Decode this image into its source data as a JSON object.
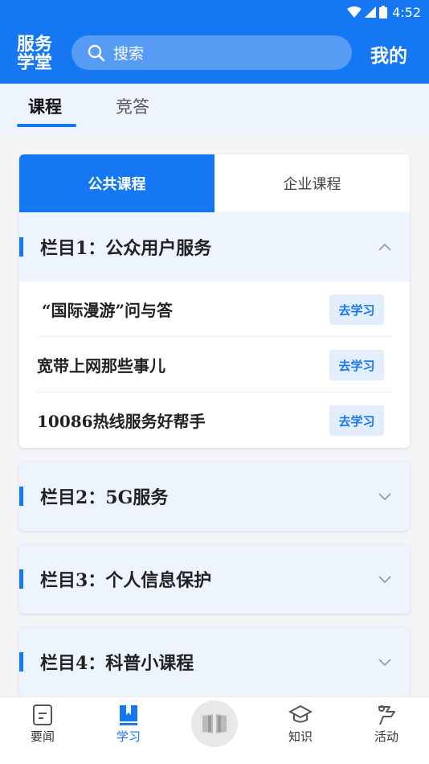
{
  "status_bar": {
    "time": "4:52"
  },
  "app_bar": {
    "logo_line1": "服务",
    "logo_line2": "学堂",
    "search_placeholder": "搜索",
    "mine_label": "我的"
  },
  "tabs": [
    {
      "label": "课程",
      "active": true
    },
    {
      "label": "竞答",
      "active": false
    }
  ],
  "segments": [
    {
      "label": "公共课程",
      "active": true
    },
    {
      "label": "企业课程",
      "active": false
    }
  ],
  "sections": [
    {
      "title": "栏目1：公众用户服务",
      "expanded": true,
      "courses": [
        {
          "title": "“国际漫游”问与答",
          "action": "去学习"
        },
        {
          "title": "宽带上网那些事儿",
          "action": "去学习"
        },
        {
          "title": "10086热线服务好帮手",
          "action": "去学习"
        }
      ]
    },
    {
      "title": "栏目2：5G服务",
      "expanded": false
    },
    {
      "title": "栏目3：个人信息保护",
      "expanded": false
    },
    {
      "title": "栏目4：科普小课程",
      "expanded": false
    }
  ],
  "bottom_nav": [
    {
      "label": "要闻",
      "icon": "news-icon",
      "active": false
    },
    {
      "label": "学习",
      "icon": "study-icon",
      "active": true
    },
    {
      "label": "",
      "icon": "book-icon",
      "active": false
    },
    {
      "label": "知识",
      "icon": "graduation-cap-icon",
      "active": false
    },
    {
      "label": "活动",
      "icon": "activity-icon",
      "active": false
    }
  ],
  "colors": {
    "primary": "#1677f2",
    "section_bg": "#eef4fd",
    "learn_bg": "#e3eefc"
  }
}
